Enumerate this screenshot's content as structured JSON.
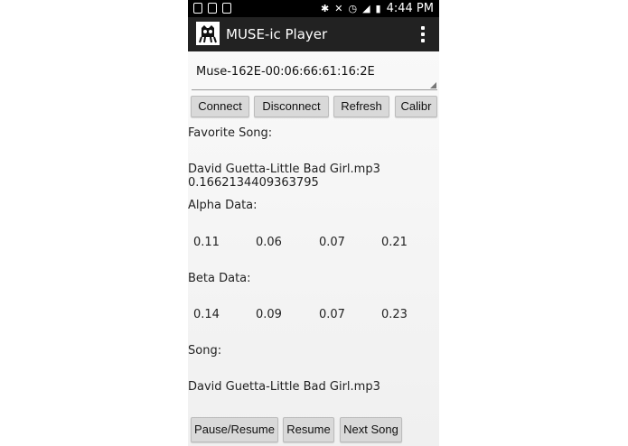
{
  "status_bar": {
    "time": "4:44 PM"
  },
  "app_bar": {
    "title": "MUSE-ic Player"
  },
  "device_spinner": {
    "selected": "Muse-162E-00:06:66:61:16:2E"
  },
  "buttons": {
    "connect": "Connect",
    "disconnect": "Disconnect",
    "refresh": "Refresh",
    "calibrate": "Calibr",
    "pause_resume": "Pause/Resume",
    "resume": "Resume",
    "next_song": "Next Song"
  },
  "favorite": {
    "label": "Favorite Song:",
    "song": "David Guetta-Little Bad Girl.mp3",
    "score": "0.1662134409363795"
  },
  "alpha": {
    "label": "Alpha Data:",
    "values": [
      "0.11",
      "0.06",
      "0.07",
      "0.21"
    ]
  },
  "beta": {
    "label": "Beta Data:",
    "values": [
      "0.14",
      "0.09",
      "0.07",
      "0.23"
    ]
  },
  "song": {
    "label": "Song:",
    "value": "David Guetta-Little Bad Girl.mp3"
  }
}
